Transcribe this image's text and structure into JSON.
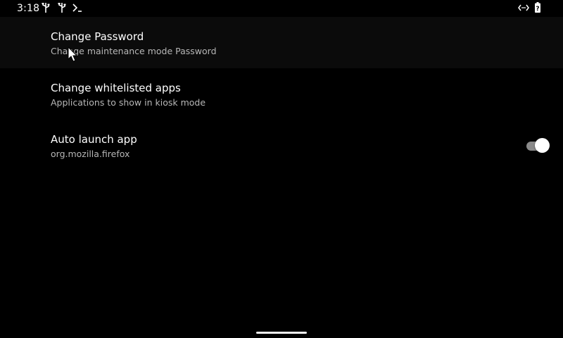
{
  "status_bar": {
    "time": "3:18",
    "left_icons": [
      "usb-icon",
      "usb-icon",
      "terminal-icon"
    ],
    "right_icons": [
      "ethernet-icon",
      "battery-unknown-icon"
    ]
  },
  "preferences": [
    {
      "title": "Change Password",
      "summary": "Change maintenance mode Password"
    },
    {
      "title": "Change whitelisted apps",
      "summary": "Applications to show in kiosk mode"
    },
    {
      "title": "Auto launch app",
      "summary": "org.mozilla.firefox",
      "toggle_on": true
    }
  ],
  "colors": {
    "background": "#000000",
    "title_text": "#ffffff",
    "summary_text": "#b7b7b7",
    "switch_track": "#8a8a8a",
    "switch_thumb": "#ffffff"
  }
}
